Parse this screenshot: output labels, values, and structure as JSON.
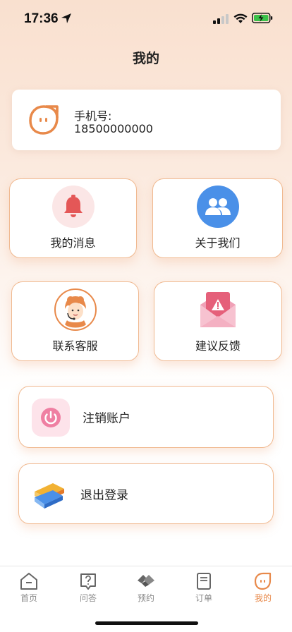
{
  "status_bar": {
    "time": "17:36"
  },
  "header": {
    "title": "我的"
  },
  "profile": {
    "phone_label": "手机号:",
    "phone_number": "18500000000"
  },
  "grid": [
    {
      "label": "我的消息",
      "icon": "bell-icon"
    },
    {
      "label": "关于我们",
      "icon": "users-icon"
    },
    {
      "label": "联系客服",
      "icon": "customer-service-icon"
    },
    {
      "label": "建议反馈",
      "icon": "feedback-mail-icon"
    }
  ],
  "actions": {
    "cancel_account": "注销账户",
    "logout": "退出登录"
  },
  "tabs": [
    {
      "label": "首页",
      "icon": "home-icon"
    },
    {
      "label": "问答",
      "icon": "question-icon"
    },
    {
      "label": "预约",
      "icon": "handshake-icon"
    },
    {
      "label": "订单",
      "icon": "order-icon"
    },
    {
      "label": "我的",
      "icon": "profile-icon",
      "active": true
    }
  ],
  "colors": {
    "accent": "#e8894a",
    "card_border": "#f0b990",
    "bell_red": "#e45757",
    "users_blue": "#4a90e8",
    "feedback_pink": "#e5607a"
  }
}
